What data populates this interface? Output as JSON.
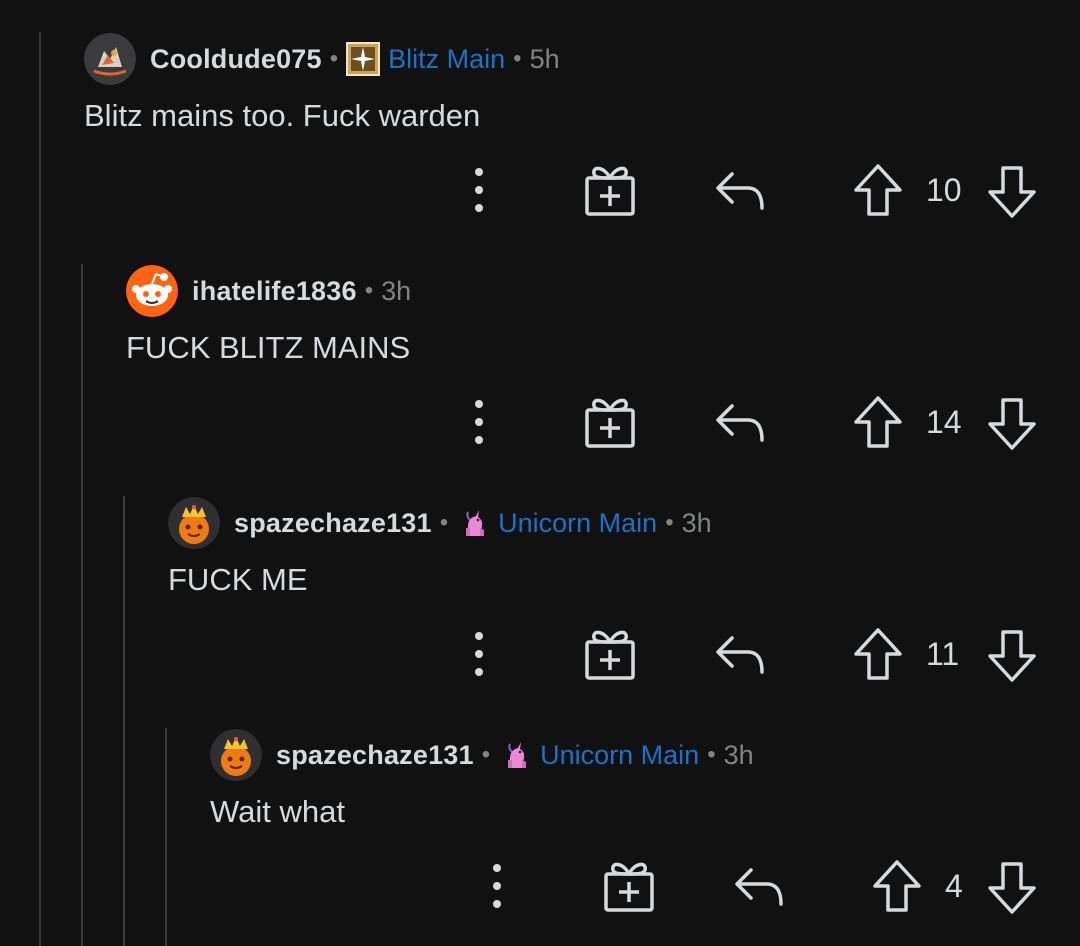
{
  "comments": [
    {
      "username": "Cooldude075",
      "flair": "Blitz Main",
      "flair_icon": "blitz-badge-icon",
      "time": "5h",
      "body": "Blitz mains too. Fuck warden",
      "score": "10",
      "avatar": "fox-avatar"
    },
    {
      "username": "ihatelife1836",
      "flair": "",
      "time": "3h",
      "body": "FUCK BLITZ MAINS",
      "score": "14",
      "avatar": "snoo-avatar"
    },
    {
      "username": "spazechaze131",
      "flair": "Unicorn Main",
      "flair_icon": "unicorn-icon",
      "time": "3h",
      "body": "FUCK ME",
      "score": "11",
      "avatar": "crowned-pumpkin-avatar"
    },
    {
      "username": "spazechaze131",
      "flair": "Unicorn Main",
      "flair_icon": "unicorn-icon",
      "time": "3h",
      "body": "Wait what",
      "score": "4",
      "avatar": "crowned-pumpkin-avatar"
    }
  ],
  "colors": {
    "background": "#111111",
    "text": "#d7dadc",
    "muted": "#818384",
    "flair": "#1a73c9",
    "thread_line": "#3a3a3c"
  },
  "icons": [
    "more-options-icon",
    "gift-icon",
    "reply-icon",
    "upvote-icon",
    "downvote-icon"
  ]
}
